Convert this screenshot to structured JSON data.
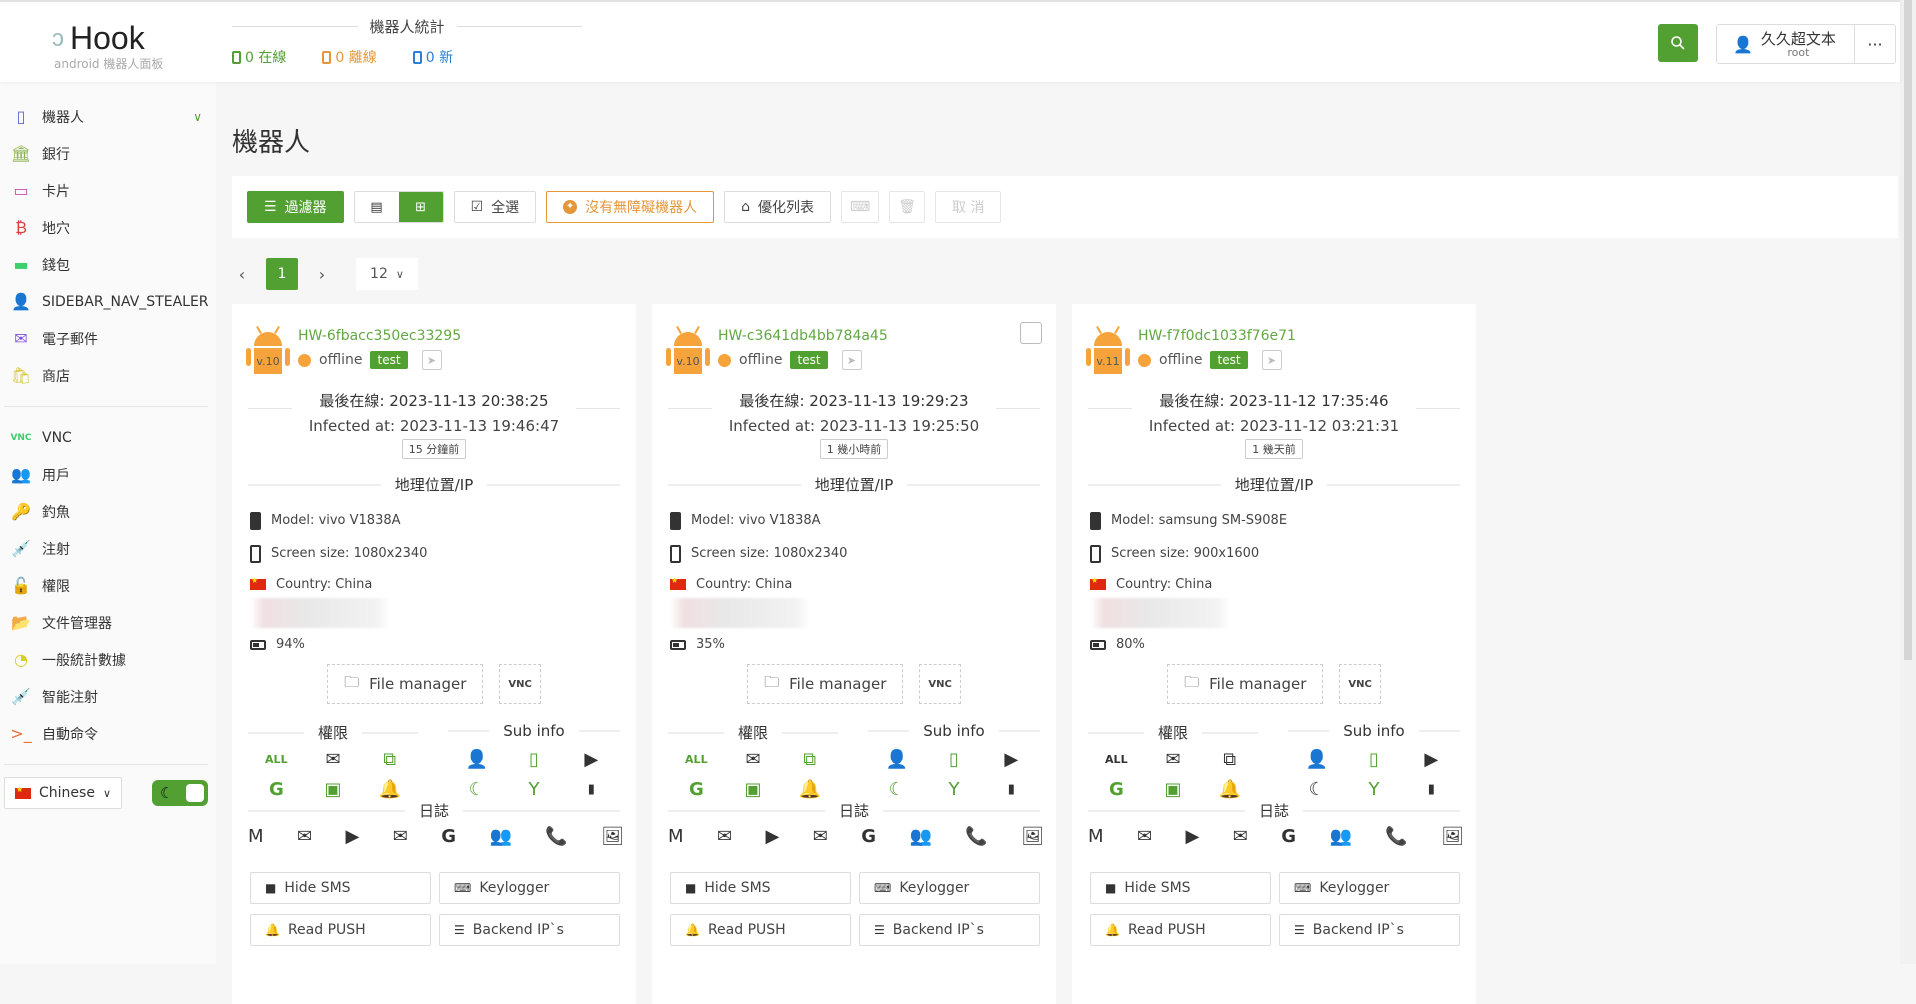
{
  "app": {
    "name": "Hook",
    "subtitle": "android 機器人面板"
  },
  "stats": {
    "title": "機器人統計",
    "online": "0 在線",
    "offline": "0 離線",
    "new": "0 新",
    "colors": {
      "online": "#52a032",
      "offline": "#e4973a",
      "new": "#2d7fd4"
    }
  },
  "user": {
    "name": "久久超文本",
    "role": "root",
    "more": "···"
  },
  "sidebar": {
    "items": [
      {
        "label": "機器人",
        "icon": "phone-icon",
        "glyph": "▯",
        "color": "#5468d4"
      },
      {
        "label": "銀行",
        "icon": "bank-icon",
        "glyph": "🏛",
        "color": "#8ab34a"
      },
      {
        "label": "卡片",
        "icon": "credit-card-icon",
        "glyph": "▭",
        "color": "#c04fc0"
      },
      {
        "label": "地穴",
        "icon": "bitcoin-icon",
        "glyph": "₿",
        "color": "#d84040"
      },
      {
        "label": "錢包",
        "icon": "wallet-icon",
        "glyph": "▬",
        "color": "#3ccf6a"
      },
      {
        "label": "SIDEBAR_NAV_STEALER",
        "icon": "stealer-icon",
        "glyph": "👤",
        "color": "#3ccf6a"
      },
      {
        "label": "電子郵件",
        "icon": "envelope-icon",
        "glyph": "✉",
        "color": "#8050d8"
      },
      {
        "label": "商店",
        "icon": "shopping-bag-icon",
        "glyph": "🛍",
        "color": "#d8c840"
      }
    ],
    "items2": [
      {
        "label": "VNC",
        "icon": "vnc-icon",
        "glyph": "VNC",
        "color": "#3ccf6a"
      },
      {
        "label": "用戶",
        "icon": "users-gear-icon",
        "glyph": "👥",
        "color": "#3aa8d8"
      },
      {
        "label": "釣魚",
        "icon": "key-icon",
        "glyph": "🔑",
        "color": "#3a8ee0"
      },
      {
        "label": "注射",
        "icon": "syringe-icon",
        "glyph": "💉",
        "color": "#d840d8"
      },
      {
        "label": "權限",
        "icon": "unlock-icon",
        "glyph": "🔓",
        "color": "#e0d040"
      },
      {
        "label": "文件管理器",
        "icon": "folder-open-icon",
        "glyph": "📂",
        "color": "#e8703a"
      },
      {
        "label": "一般統計數據",
        "icon": "pie-chart-icon",
        "glyph": "◔",
        "color": "#d8d020"
      },
      {
        "label": "智能注射",
        "icon": "syringe-icon",
        "glyph": "💉",
        "color": "#3ccf6a"
      },
      {
        "label": "自動命令",
        "icon": "terminal-icon",
        "glyph": ">_",
        "color": "#e8703a"
      }
    ],
    "language": "Chinese"
  },
  "page": {
    "title": "機器人"
  },
  "toolbar": {
    "filter": "過濾器",
    "select_all": "全選",
    "no_accessibility": "沒有無障礙機器人",
    "optimize": "優化列表",
    "cancel": "取 消"
  },
  "pager": {
    "current": "1",
    "page_size": "12"
  },
  "card_labels": {
    "last_online": "最後在線",
    "infected_at": "Infected at",
    "geo_title": "地理位置/IP",
    "model": "Model",
    "screen": "Screen size",
    "country": "Country",
    "file_manager": "File manager",
    "vnc": "VNC",
    "perms_title": "權限",
    "subinfo_title": "Sub info",
    "logs_title": "日誌",
    "all": "ALL",
    "actions": [
      "Hide SMS",
      "Keylogger",
      "Read PUSH",
      "Backend IP`s"
    ]
  },
  "bots": [
    {
      "id": "HW-6fbacc350ec33295",
      "version": "v.10",
      "status": "offline",
      "tag": "test",
      "last_online": "2023-11-13 20:38:25",
      "infected_at": "2023-11-13 19:46:47",
      "ago": "15 分鐘前",
      "model": "vivo V1838A",
      "screen": "1080x2340",
      "country": "China",
      "battery": "94%",
      "checkbox": false,
      "perm_all_green": true,
      "perm_overlay_green": true,
      "moon_green": true
    },
    {
      "id": "HW-c3641db4bb784a45",
      "version": "v.10",
      "status": "offline",
      "tag": "test",
      "last_online": "2023-11-13 19:29:23",
      "infected_at": "2023-11-13 19:25:50",
      "ago": "1 幾小時前",
      "model": "vivo V1838A",
      "screen": "1080x2340",
      "country": "China",
      "battery": "35%",
      "checkbox": true,
      "perm_all_green": true,
      "perm_overlay_green": true,
      "moon_green": true
    },
    {
      "id": "HW-f7f0dc1033f76e71",
      "version": "v.11",
      "status": "offline",
      "tag": "test",
      "last_online": "2023-11-12 17:35:46",
      "infected_at": "2023-11-12 03:21:31",
      "ago": "1 幾天前",
      "model": "samsung SM-S908E",
      "screen": "900x1600",
      "country": "China",
      "battery": "80%",
      "checkbox": false,
      "perm_all_green": false,
      "perm_overlay_green": false,
      "moon_green": false
    }
  ]
}
